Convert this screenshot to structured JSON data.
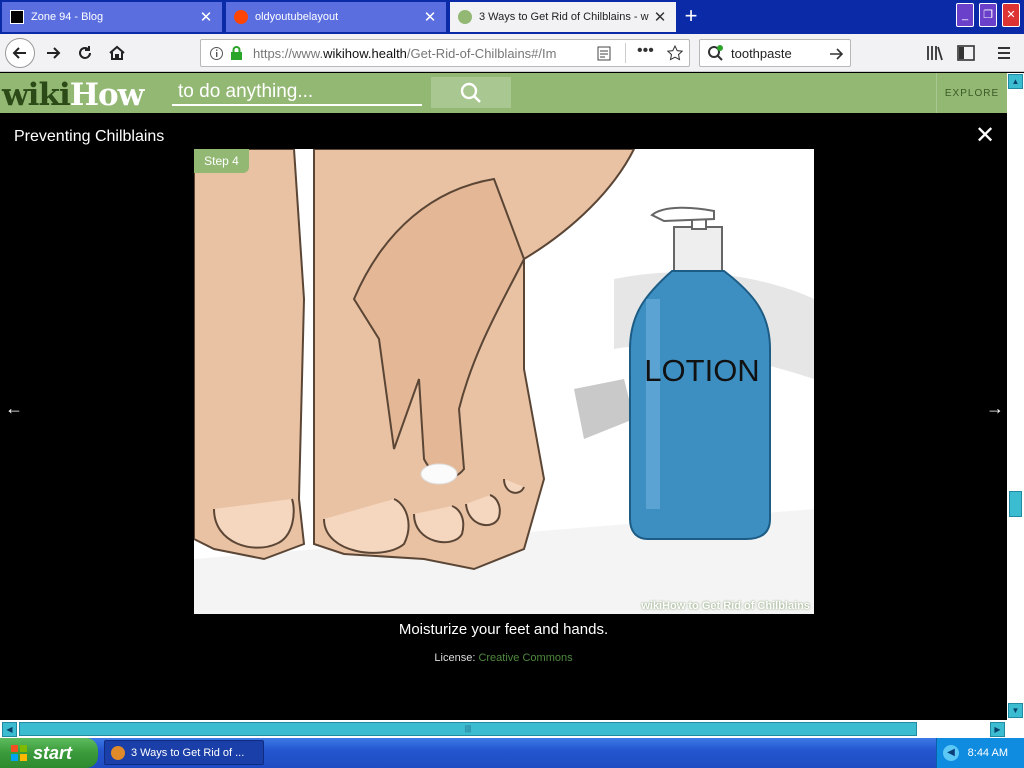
{
  "browser": {
    "tabs": [
      {
        "title": "Zone 94 - Blog",
        "active": false
      },
      {
        "title": "oldyoutubelayout",
        "active": false
      },
      {
        "title": "3 Ways to Get Rid of Chilblains - w",
        "active": true
      }
    ],
    "url_prefix": "https://www.",
    "url_host": "wikihow.health",
    "url_path": "/Get-Rid-of-Chilblains#/Im",
    "search_value": "toothpaste"
  },
  "site": {
    "logo_part1": "wiki",
    "logo_part2": "How",
    "search_placeholder": "to do anything...",
    "explore_label": "EXPLORE",
    "accent_color": "#93b874"
  },
  "lightbox": {
    "title": "Preventing Chilblains",
    "step_label": "Step 4",
    "image_text": "LOTION",
    "watermark": "wikiHow to Get Rid of Chilblains",
    "caption": "Moisturize your feet and hands.",
    "license_label": "License:",
    "license_link": "Creative Commons"
  },
  "taskbar": {
    "start_label": "start",
    "task_item": "3 Ways to Get Rid of ...",
    "clock": "8:44 AM"
  }
}
